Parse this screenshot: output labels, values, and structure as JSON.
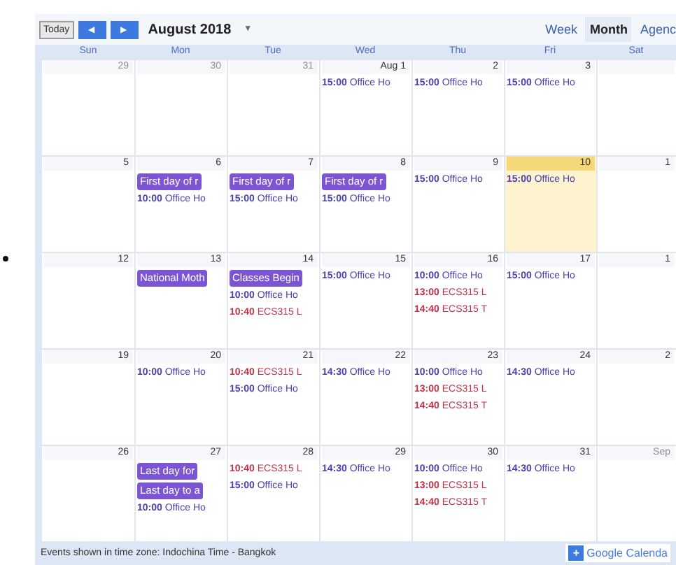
{
  "toolbar": {
    "today_button": "Today",
    "prev_button": "◀",
    "next_button": "▶",
    "month_title": "August 2018",
    "dropdown": "▼"
  },
  "view_tabs": [
    {
      "label": "Week",
      "selected": false
    },
    {
      "label": "Month",
      "selected": true
    },
    {
      "label": "Agenc",
      "selected": false
    }
  ],
  "weekdays": [
    "Sun",
    "Mon",
    "Tue",
    "Wed",
    "Thu",
    "Fri",
    "Sat"
  ],
  "weeks": [
    {
      "days": [
        {
          "date": "29",
          "in_month": false,
          "today": false
        },
        {
          "date": "30",
          "in_month": false,
          "today": false
        },
        {
          "date": "31",
          "in_month": false,
          "today": false
        },
        {
          "date": "Aug 1",
          "in_month": true,
          "today": false,
          "events": [
            {
              "kind": "timed",
              "time": "15:00",
              "title": "Office Ho",
              "color": "#4b3fb0"
            }
          ]
        },
        {
          "date": "2",
          "in_month": true,
          "today": false,
          "events": [
            {
              "kind": "timed",
              "time": "15:00",
              "title": "Office Ho",
              "color": "#4b3fb0"
            }
          ]
        },
        {
          "date": "3",
          "in_month": true,
          "today": false,
          "events": [
            {
              "kind": "timed",
              "time": "15:00",
              "title": "Office Ho",
              "color": "#4b3fb0"
            }
          ]
        },
        {
          "today": false
        }
      ]
    },
    {
      "days": [
        {
          "date": "5",
          "in_month": true,
          "today": false
        },
        {
          "date": "6",
          "in_month": true,
          "today": false,
          "events": [
            {
              "kind": "allday",
              "title": "First day of r",
              "color": "#7c55d3"
            },
            {
              "kind": "timed",
              "time": "10:00",
              "title": "Office Ho",
              "color": "#4b3fb0"
            }
          ]
        },
        {
          "date": "7",
          "in_month": true,
          "today": false,
          "events": [
            {
              "kind": "allday",
              "title": "First day of r",
              "color": "#7c55d3"
            },
            {
              "kind": "timed",
              "time": "15:00",
              "title": "Office Ho",
              "color": "#4b3fb0"
            }
          ]
        },
        {
          "date": "8",
          "in_month": true,
          "today": false,
          "events": [
            {
              "kind": "allday",
              "title": "First day of r",
              "color": "#7c55d3"
            },
            {
              "kind": "timed",
              "time": "15:00",
              "title": "Office Ho",
              "color": "#4b3fb0"
            }
          ]
        },
        {
          "date": "9",
          "in_month": true,
          "today": false,
          "events": [
            {
              "kind": "timed",
              "time": "15:00",
              "title": "Office Ho",
              "color": "#4b3fb0"
            }
          ]
        },
        {
          "date": "10",
          "in_month": true,
          "today": true,
          "events": [
            {
              "kind": "timed",
              "time": "15:00",
              "title": "Office Ho",
              "color": "#4b3fb0"
            }
          ]
        },
        {
          "date": "1",
          "in_month": true,
          "today": false
        }
      ]
    },
    {
      "days": [
        {
          "date": "12",
          "in_month": true,
          "today": false
        },
        {
          "date": "13",
          "in_month": true,
          "today": false,
          "events": [
            {
              "kind": "allday",
              "title": "National Moth",
              "color": "#7c55d3"
            }
          ]
        },
        {
          "date": "14",
          "in_month": true,
          "today": false,
          "events": [
            {
              "kind": "allday",
              "title": "Classes Begin",
              "color": "#7c55d3"
            },
            {
              "kind": "timed",
              "time": "10:00",
              "title": "Office Ho",
              "color": "#4b3fb0"
            },
            {
              "kind": "timed",
              "time": "10:40",
              "title": "ECS315 L",
              "color": "#c0344a"
            }
          ]
        },
        {
          "date": "15",
          "in_month": true,
          "today": false,
          "events": [
            {
              "kind": "timed",
              "time": "15:00",
              "title": "Office Ho",
              "color": "#4b3fb0"
            }
          ]
        },
        {
          "date": "16",
          "in_month": true,
          "today": false,
          "events": [
            {
              "kind": "timed",
              "time": "10:00",
              "title": "Office Ho",
              "color": "#4b3fb0"
            },
            {
              "kind": "timed",
              "time": "13:00",
              "title": "ECS315 L",
              "color": "#c0344a"
            },
            {
              "kind": "timed",
              "time": "14:40",
              "title": "ECS315 T",
              "color": "#c0344a"
            }
          ]
        },
        {
          "date": "17",
          "in_month": true,
          "today": false,
          "events": [
            {
              "kind": "timed",
              "time": "15:00",
              "title": "Office Ho",
              "color": "#4b3fb0"
            }
          ]
        },
        {
          "date": "1",
          "in_month": true,
          "today": false
        }
      ]
    },
    {
      "days": [
        {
          "date": "19",
          "in_month": true,
          "today": false
        },
        {
          "date": "20",
          "in_month": true,
          "today": false,
          "events": [
            {
              "kind": "timed",
              "time": "10:00",
              "title": "Office Ho",
              "color": "#4b3fb0"
            }
          ]
        },
        {
          "date": "21",
          "in_month": true,
          "today": false,
          "events": [
            {
              "kind": "timed",
              "time": "10:40",
              "title": "ECS315 L",
              "color": "#c0344a"
            },
            {
              "kind": "timed",
              "time": "15:00",
              "title": "Office Ho",
              "color": "#4b3fb0"
            }
          ]
        },
        {
          "date": "22",
          "in_month": true,
          "today": false,
          "events": [
            {
              "kind": "timed",
              "time": "14:30",
              "title": "Office Ho",
              "color": "#4b3fb0"
            }
          ]
        },
        {
          "date": "23",
          "in_month": true,
          "today": false,
          "events": [
            {
              "kind": "timed",
              "time": "10:00",
              "title": "Office Ho",
              "color": "#4b3fb0"
            },
            {
              "kind": "timed",
              "time": "13:00",
              "title": "ECS315 L",
              "color": "#c0344a"
            },
            {
              "kind": "timed",
              "time": "14:40",
              "title": "ECS315 T",
              "color": "#c0344a"
            }
          ]
        },
        {
          "date": "24",
          "in_month": true,
          "today": false,
          "events": [
            {
              "kind": "timed",
              "time": "14:30",
              "title": "Office Ho",
              "color": "#4b3fb0"
            }
          ]
        },
        {
          "date": "2",
          "in_month": true,
          "today": false
        }
      ]
    },
    {
      "days": [
        {
          "date": "26",
          "in_month": true,
          "today": false
        },
        {
          "date": "27",
          "in_month": true,
          "today": false,
          "events": [
            {
              "kind": "allday",
              "title": "Last day for",
              "color": "#7c55d3"
            },
            {
              "kind": "allday",
              "title": "Last day to a",
              "color": "#7c55d3"
            },
            {
              "kind": "timed",
              "time": "10:00",
              "title": "Office Ho",
              "color": "#4b3fb0"
            }
          ]
        },
        {
          "date": "28",
          "in_month": true,
          "today": false,
          "events": [
            {
              "kind": "timed",
              "time": "10:40",
              "title": "ECS315 L",
              "color": "#c0344a"
            },
            {
              "kind": "timed",
              "time": "15:00",
              "title": "Office Ho",
              "color": "#4b3fb0"
            }
          ]
        },
        {
          "date": "29",
          "in_month": true,
          "today": false,
          "events": [
            {
              "kind": "timed",
              "time": "14:30",
              "title": "Office Ho",
              "color": "#4b3fb0"
            }
          ]
        },
        {
          "date": "30",
          "in_month": true,
          "today": false,
          "events": [
            {
              "kind": "timed",
              "time": "10:00",
              "title": "Office Ho",
              "color": "#4b3fb0"
            },
            {
              "kind": "timed",
              "time": "13:00",
              "title": "ECS315 L",
              "color": "#c0344a"
            },
            {
              "kind": "timed",
              "time": "14:40",
              "title": "ECS315 T",
              "color": "#c0344a"
            }
          ]
        },
        {
          "date": "31",
          "in_month": true,
          "today": false,
          "events": [
            {
              "kind": "timed",
              "time": "14:30",
              "title": "Office Ho",
              "color": "#4b3fb0"
            }
          ]
        },
        {
          "date": "Sep",
          "in_month": false,
          "today": false
        }
      ]
    }
  ],
  "footer": {
    "timezone_note": "Events shown in time zone: Indochina Time - Bangkok",
    "badge_plus": "+",
    "badge_label": "Google Calenda"
  }
}
